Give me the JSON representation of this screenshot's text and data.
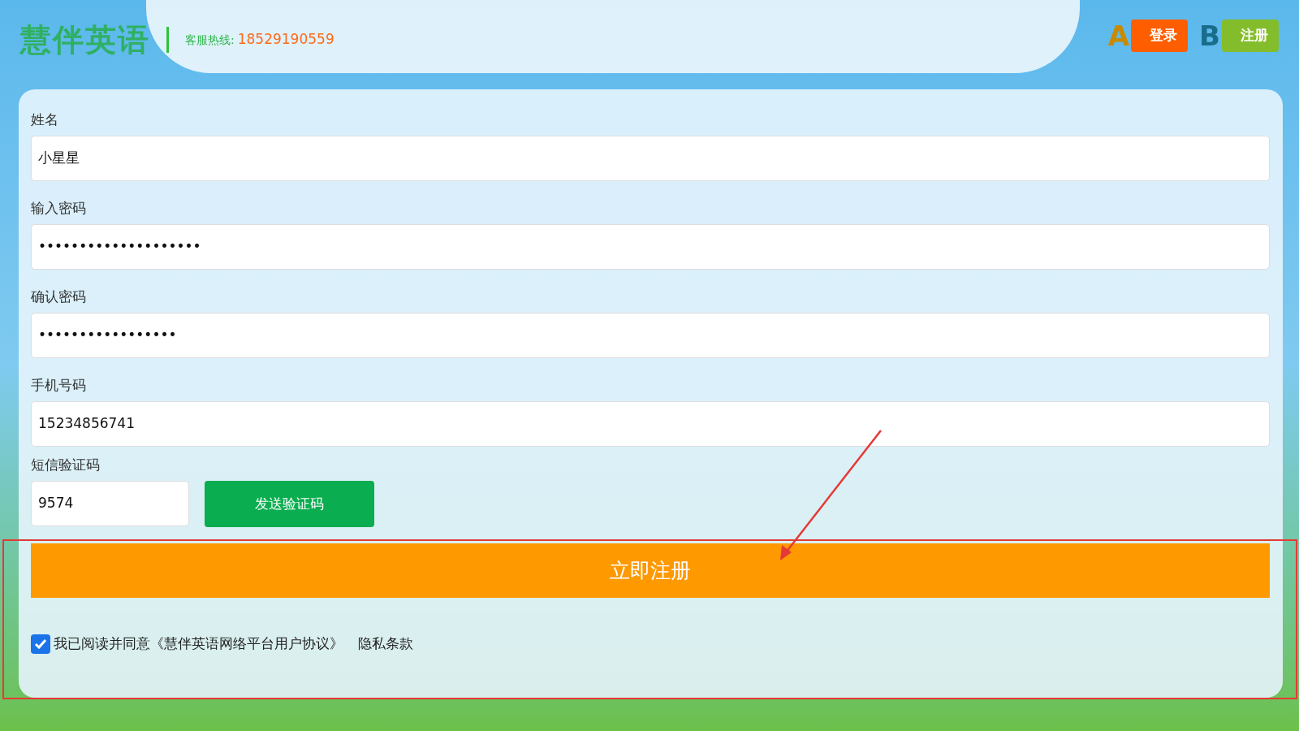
{
  "header": {
    "logo": "慧伴英语",
    "hotline_label": "客服热线:",
    "hotline_number": "18529190559",
    "buttons": [
      {
        "label": "登录",
        "badge": "A"
      },
      {
        "label": "注册",
        "badge": "B"
      }
    ]
  },
  "form": {
    "fields": [
      {
        "label": "姓名",
        "value": "小星星"
      },
      {
        "label": "输入密码",
        "value": "••••••••••••••••••••"
      },
      {
        "label": "确认密码",
        "value": "•••••••••••••••••"
      },
      {
        "label": "手机号码",
        "value": "15234856741"
      }
    ],
    "sms_code": {
      "label": "短信验证码",
      "value": "9574",
      "button": "发送验证码"
    },
    "submit": "立即注册",
    "agreement": {
      "checked": true,
      "text": "我已阅读并同意《慧伴英语网络平台用户协议》",
      "privacy_link": "隐私条款"
    }
  }
}
